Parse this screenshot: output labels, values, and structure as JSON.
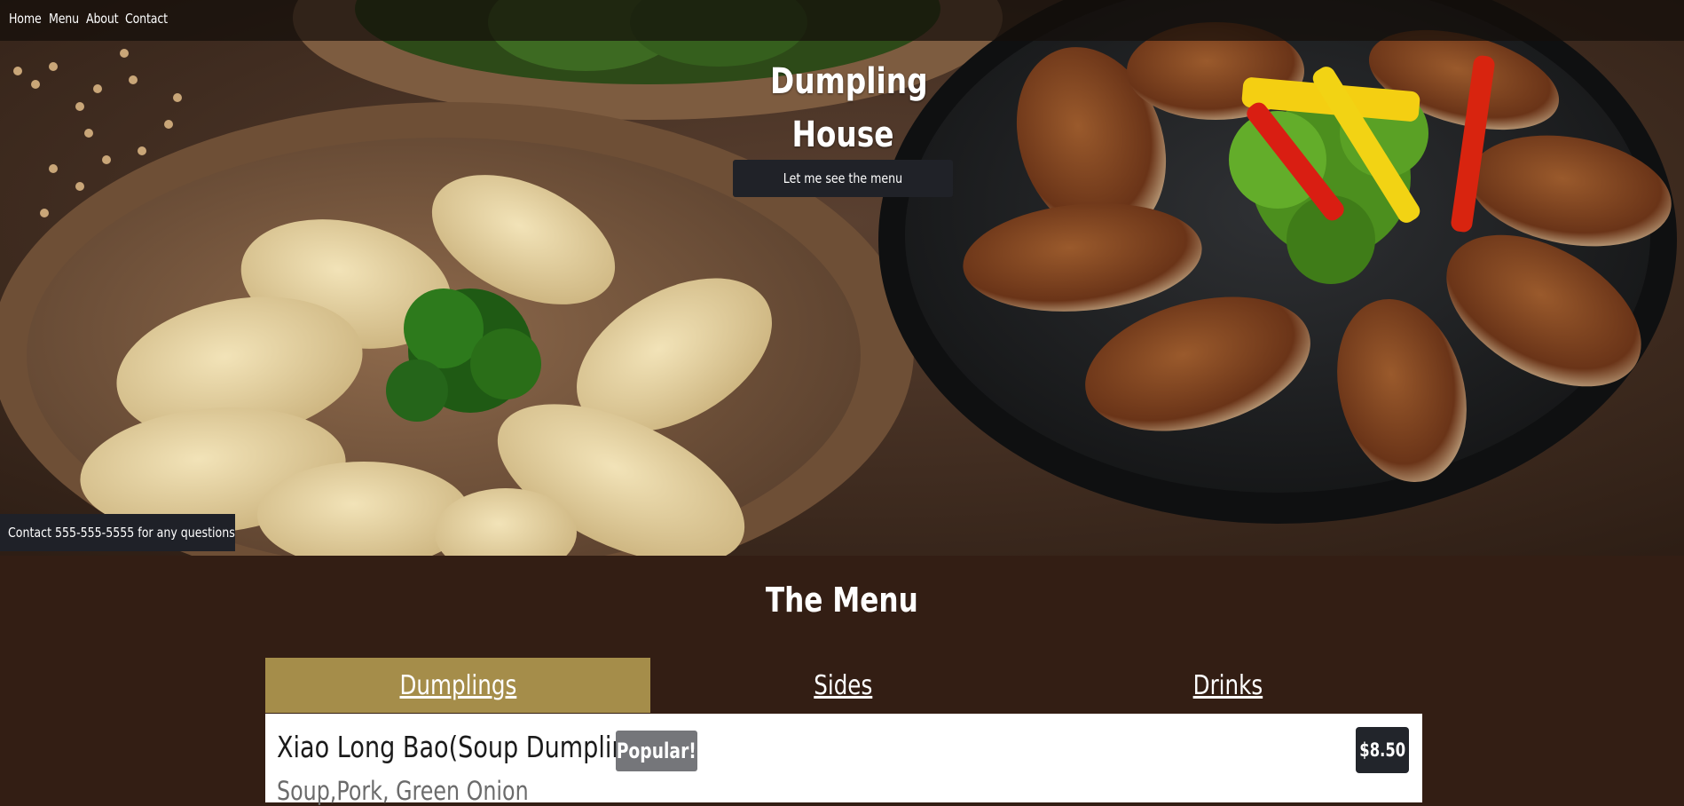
{
  "nav": {
    "items": [
      {
        "label": "Home"
      },
      {
        "label": "Menu"
      },
      {
        "label": "About"
      },
      {
        "label": "Contact"
      }
    ]
  },
  "hero": {
    "title_line1": "Dumpling",
    "title_line2": "House",
    "button_label": "Let me see the menu",
    "contact_text": "Contact 555-555-5555 for any questions"
  },
  "menu": {
    "heading": "The Menu",
    "tabs": [
      {
        "label": "Dumplings",
        "active": true
      },
      {
        "label": "Sides",
        "active": false
      },
      {
        "label": "Drinks",
        "active": false
      }
    ],
    "items": [
      {
        "name": "Xiao Long Bao(Soup Dumplings)",
        "badge": "Popular!",
        "price": "$8.50",
        "description": "Soup,Pork, Green Onion"
      }
    ]
  },
  "colors": {
    "page_bg": "#331e14",
    "active_tab": "#a58d4a",
    "dark_button": "#202228",
    "badge_grey": "#75767a"
  }
}
